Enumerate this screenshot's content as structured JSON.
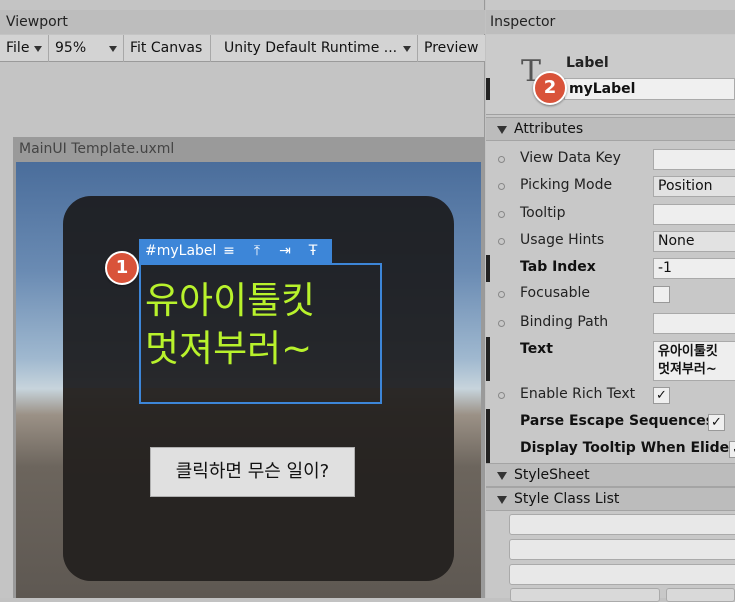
{
  "viewport": {
    "title": "Viewport",
    "toolbar": {
      "file": "File",
      "zoom": "95%",
      "fit": "Fit Canvas",
      "theme": "Unity Default Runtime ...",
      "preview": "Preview"
    },
    "document_title": "MainUI Template.uxml",
    "label_tag": "#myLabel",
    "label_text": "유아이툴킷\n멋져부러~",
    "button_text": "클릭하면 무슨 일이?",
    "callouts": [
      "1",
      "2"
    ]
  },
  "inspector": {
    "title": "Inspector",
    "element_type": "Label",
    "element_name": "myLabel",
    "sections": {
      "attributes": "Attributes",
      "stylesheet": "StyleSheet",
      "style_class_list": "Style Class List"
    },
    "attributes": [
      {
        "label": "View Data Key",
        "value": "",
        "kind": "field"
      },
      {
        "label": "Picking Mode",
        "value": "Position",
        "kind": "dropdown"
      },
      {
        "label": "Tooltip",
        "value": "",
        "kind": "field"
      },
      {
        "label": "Usage Hints",
        "value": "None",
        "kind": "dropdown"
      },
      {
        "label": "Tab Index",
        "value": "-1",
        "kind": "field"
      },
      {
        "label": "Focusable",
        "value": "",
        "kind": "checkbox"
      },
      {
        "label": "Binding Path",
        "value": "",
        "kind": "field"
      },
      {
        "label": "Text",
        "value": "유아이툴킷\n멋져부러~",
        "kind": "textarea"
      },
      {
        "label": "Enable Rich Text",
        "value": "✓",
        "kind": "checkbox"
      },
      {
        "label": "Parse Escape Sequences",
        "value": "✓",
        "kind": "checkbox"
      },
      {
        "label": "Display Tooltip When Elided",
        "value": "✓",
        "kind": "checkbox"
      }
    ]
  },
  "colors": {
    "accent_blue": "#3d86d8",
    "label_text_green": "#b8f22c",
    "callout_red": "#d9533a"
  }
}
